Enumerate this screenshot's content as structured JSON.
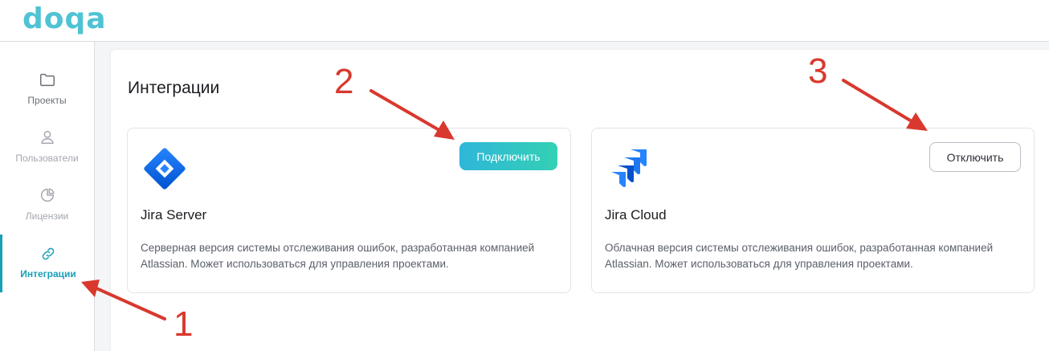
{
  "app": {
    "logo": "doqa"
  },
  "sidebar": {
    "items": [
      {
        "label": "Проекты",
        "icon": "folder-icon",
        "color": "#6b6f78"
      },
      {
        "label": "Пользователи",
        "icon": "user-icon",
        "color": "#a3a7ae"
      },
      {
        "label": "Лицензии",
        "icon": "pie-chart-icon",
        "color": "#a3a7ae"
      },
      {
        "label": "Интеграции",
        "icon": "link-icon",
        "color": "#1a9fb8",
        "active": true
      }
    ]
  },
  "main": {
    "title": "Интеграции",
    "cards": [
      {
        "title": "Jira Server",
        "description": "Серверная версия системы отслеживания ошибок, разработанная компанией Atlassian. Может использоваться для управления проектами.",
        "button_label": "Подключить",
        "icon": "jira-server-logo-icon"
      },
      {
        "title": "Jira Cloud",
        "description": "Облачная версия системы отслеживания ошибок, разработанная компанией Atlassian. Может использоваться для управления проектами.",
        "button_label": "Отключить",
        "icon": "jira-cloud-logo-icon"
      }
    ]
  },
  "annotations": {
    "marker_1": "1",
    "marker_2": "2",
    "marker_3": "3",
    "color": "#d9382d"
  },
  "colors": {
    "accent": "#1a9fb8",
    "logo": "#4fc3d3",
    "jira_blue": "#2684ff"
  }
}
